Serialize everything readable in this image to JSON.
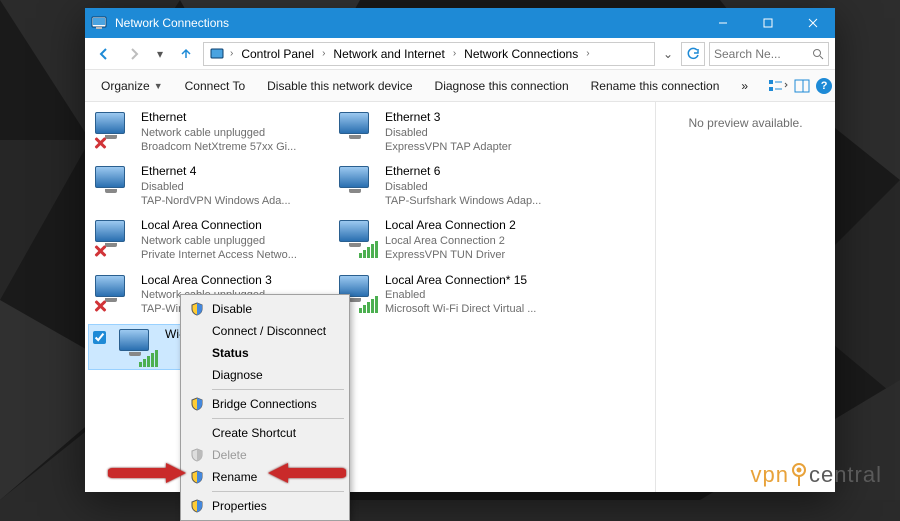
{
  "window": {
    "title": "Network Connections"
  },
  "addr": {
    "crumbs": [
      "Control Panel",
      "Network and Internet",
      "Network Connections"
    ],
    "search_placeholder": "Search Ne..."
  },
  "cmd": {
    "organize": "Organize",
    "items": [
      "Connect To",
      "Disable this network device",
      "Diagnose this connection",
      "Rename this connection"
    ],
    "overflow": "»"
  },
  "connections": {
    "col1": [
      {
        "name": "Ethernet",
        "l2": "Network cable unplugged",
        "l3": "Broadcom NetXtreme 57xx Gi...",
        "state": "x"
      },
      {
        "name": "Ethernet 4",
        "l2": "Disabled",
        "l3": "TAP-NordVPN Windows Ada...",
        "state": "d"
      },
      {
        "name": "Local Area Connection",
        "l2": "Network cable unplugged",
        "l3": "Private Internet Access Netwo...",
        "state": "x"
      },
      {
        "name": "Local Area Connection 3",
        "l2": "Network cable unplugged",
        "l3": "TAP-Windows Adapter V9",
        "state": "x"
      },
      {
        "name": "Wi-Fi",
        "l2": "",
        "l3": "",
        "state": "sel"
      }
    ],
    "col2": [
      {
        "name": "Ethernet 3",
        "l2": "Disabled",
        "l3": "ExpressVPN TAP Adapter",
        "state": "d"
      },
      {
        "name": "Ethernet 6",
        "l2": "Disabled",
        "l3": "TAP-Surfshark Windows Adap...",
        "state": "d"
      },
      {
        "name": "Local Area Connection 2",
        "l2": "Local Area Connection 2",
        "l3": "ExpressVPN TUN Driver",
        "state": "ok"
      },
      {
        "name": "Local Area Connection* 15",
        "l2": "Enabled",
        "l3": "Microsoft Wi-Fi Direct Virtual ...",
        "state": "ok"
      }
    ]
  },
  "preview": {
    "text": "No preview available."
  },
  "menu": {
    "disable": "Disable",
    "connect": "Connect / Disconnect",
    "status": "Status",
    "diagnose": "Diagnose",
    "bridge": "Bridge Connections",
    "shortcut": "Create Shortcut",
    "delete": "Delete",
    "rename": "Rename",
    "properties": "Properties"
  },
  "logo": {
    "t1": "vpn",
    "t2": "central"
  }
}
